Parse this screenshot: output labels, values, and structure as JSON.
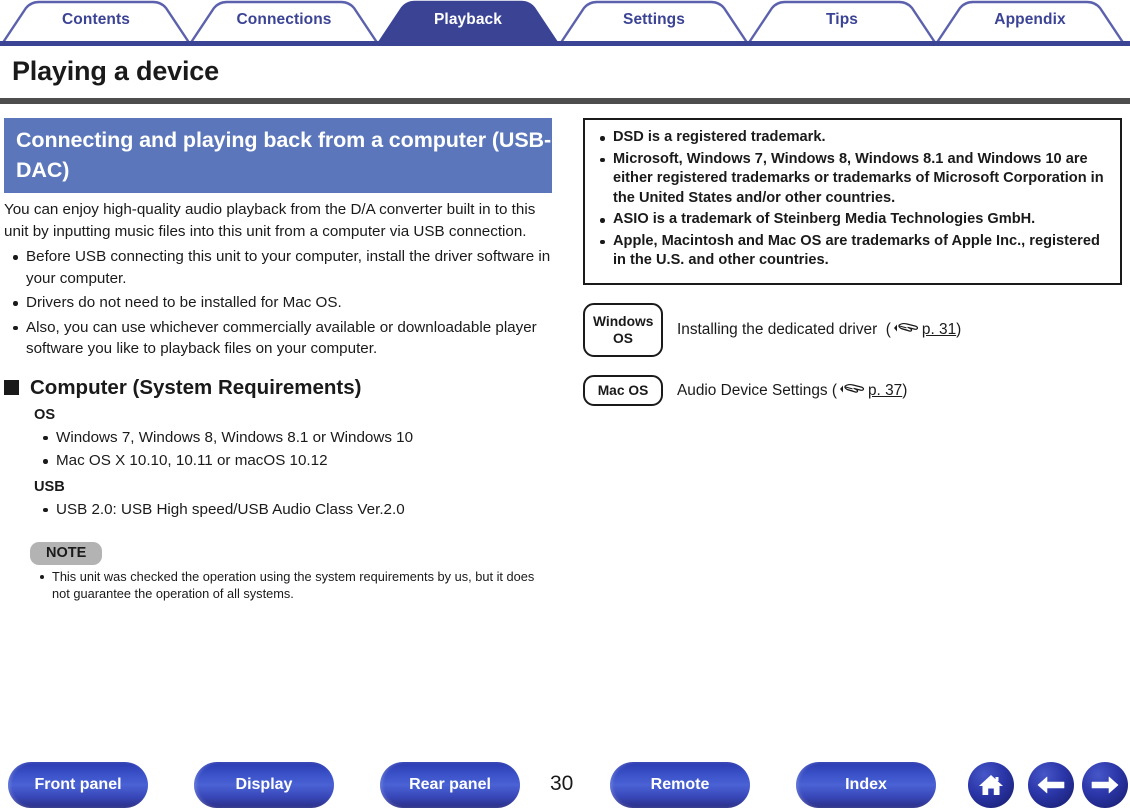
{
  "tabs": [
    {
      "label": "Contents",
      "active": false
    },
    {
      "label": "Connections",
      "active": false
    },
    {
      "label": "Playback",
      "active": true
    },
    {
      "label": "Settings",
      "active": false
    },
    {
      "label": "Tips",
      "active": false
    },
    {
      "label": "Appendix",
      "active": false
    }
  ],
  "page_title": "Playing a device",
  "section": {
    "heading": "Connecting and playing back from a computer (USB-DAC)",
    "intro": "You can enjoy high-quality audio playback from the D/A converter built in to this unit by inputting music files into this unit from a computer via USB connection.",
    "bullets": [
      "Before USB connecting this unit to your computer, install the driver software in your computer.",
      "Drivers do not need to be installed for Mac OS.",
      "Also, you can use whichever commercially available or downloadable player software you like to playback files on your computer."
    ]
  },
  "requirements": {
    "heading": "Computer (System Requirements)",
    "os_label": "OS",
    "os_items": [
      "Windows 7, Windows 8, Windows 8.1 or Windows 10",
      "Mac OS X 10.10, 10.11 or macOS 10.12"
    ],
    "usb_label": "USB",
    "usb_items": [
      "USB 2.0: USB High speed/USB Audio Class Ver.2.0"
    ]
  },
  "note": {
    "badge": "NOTE",
    "items": [
      "This unit was checked the operation using the system requirements by us, but it does not guarantee the operation of all systems."
    ]
  },
  "trademarks": [
    "DSD is a registered trademark.",
    "Microsoft, Windows 7, Windows 8, Windows 8.1 and Windows 10 are either registered trademarks or trademarks of Microsoft Corporation in the United States and/or other countries.",
    "ASIO is a trademark of Steinberg Media Technologies GmbH.",
    "Apple, Macintosh and Mac OS are trademarks of Apple Inc., registered in the U.S. and other countries."
  ],
  "os_links": [
    {
      "badge_line1": "Windows",
      "badge_line2": "OS",
      "text_before": "Installing the dedicated driver",
      "paren_open": "(",
      "link": "p. 31",
      "paren_close": ")"
    },
    {
      "badge_line1": "Mac OS",
      "badge_line2": "",
      "text_before": "Audio Device Settings",
      "paren_open": "(",
      "link": "p. 37",
      "paren_close": ")"
    }
  ],
  "footer": {
    "buttons": [
      {
        "label": "Front panel"
      },
      {
        "label": "Display"
      },
      {
        "label": "Rear panel"
      },
      {
        "label": "Remote"
      },
      {
        "label": "Index"
      }
    ],
    "page_number": "30",
    "icons": [
      {
        "name": "home-icon"
      },
      {
        "name": "arrow-left-icon"
      },
      {
        "name": "arrow-right-icon"
      }
    ]
  },
  "colors": {
    "tab_active_bg": "#3b4395",
    "tab_border": "#5b61ad",
    "tab_text": "#3b4395",
    "section_band": "#5b76ba",
    "rule": "#4d4d4d",
    "note_badge": "#b3b3b3"
  }
}
